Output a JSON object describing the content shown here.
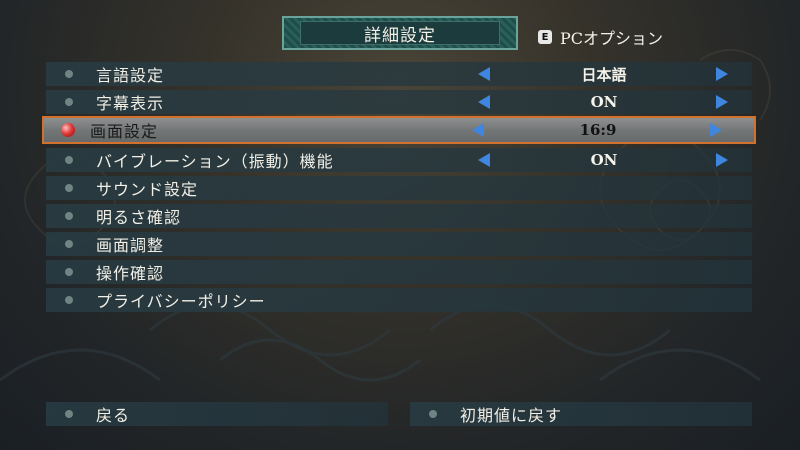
{
  "header": {
    "title": "詳細設定",
    "pc_option_key": "E",
    "pc_option_label": "PCオプション"
  },
  "settings": [
    {
      "label": "言語設定",
      "value": "日本語",
      "has_arrows": true
    },
    {
      "label": "字幕表示",
      "value": "ON",
      "has_arrows": true
    },
    {
      "label": "画面設定",
      "value": "16:9",
      "has_arrows": true,
      "selected": true
    },
    {
      "label": "バイブレーション（振動）機能",
      "value": "ON",
      "has_arrows": true
    },
    {
      "label": "サウンド設定"
    },
    {
      "label": "明るさ確認"
    },
    {
      "label": "画面調整"
    },
    {
      "label": "操作確認"
    },
    {
      "label": "プライバシーポリシー"
    }
  ],
  "footer": {
    "back_label": "戻る",
    "reset_label": "初期値に戻す"
  },
  "colors": {
    "selection_border": "#d2712e",
    "arrow": "#3f86e0",
    "selected_bullet": "#e23a3a",
    "title_frame": "#6aa39a"
  },
  "icons": {
    "left_arrow": "left-triangle",
    "right_arrow": "right-triangle",
    "bullet": "dot",
    "selected_bullet": "red-orb"
  }
}
